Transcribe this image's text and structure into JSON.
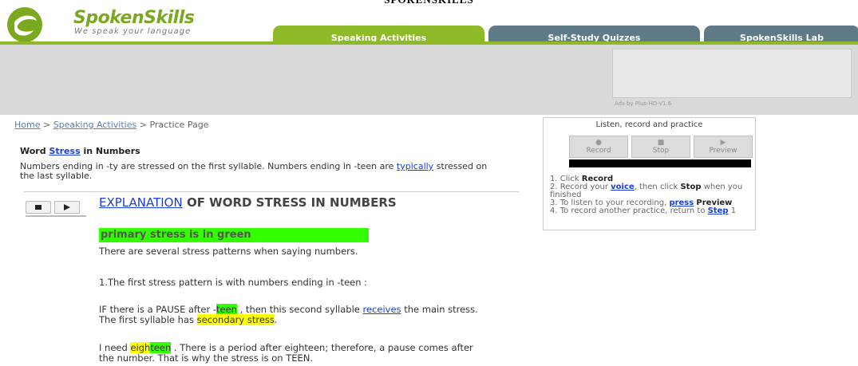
{
  "doc_title": "SPOKENSKILLS",
  "logo": {
    "title_a": "Spoken",
    "title_b": "Skills",
    "tagline": "We speak your language"
  },
  "tabs": [
    {
      "label": "Speaking Activities"
    },
    {
      "label": "Self-Study Quizzes"
    },
    {
      "label": "SpokenSkills Lab"
    }
  ],
  "ad": {
    "credit": "Ads by Plus-HD-V1.6"
  },
  "breadcrumb": {
    "home": "Home",
    "sep1": ">",
    "activities": "Speaking Activities",
    "sep2": ">",
    "current": "Practice Page"
  },
  "section": {
    "title_a": "Word",
    "title_link": "Stress",
    "title_b": "in Numbers",
    "intro_a": "Numbers ending in -ty are stressed on the first syllable. Numbers ending in -teen are",
    "intro_link": "typically",
    "intro_b": "stressed on the last syllable."
  },
  "player": {
    "stop_icon": "stop-icon",
    "play_icon": "play-icon"
  },
  "explanation": {
    "link": "EXPLANATION",
    "rest": "OF WORD STRESS IN NUMBERS",
    "primary_label": "primary stress is in green",
    "p1": "There are several stress patterns when saying numbers.",
    "p2": "1.The first stress pattern is with numbers  ending in -teen :",
    "p3_a": "IF there is a PAUSE after  -",
    "p3_hl": "teen",
    "p3_b": ", then this second syllable",
    "p3_link": "receives",
    "p3_c": "the main stress.   The first syllable has",
    "p3_hl2": "secondary stress",
    "p3_d": ".",
    "p4_a": "I need",
    "p4_hl_y": "eigh",
    "p4_hl_g": "teen",
    "p4_b": ".  There is a period after eighteen; therefore, a pause comes after the number.  That is why the stress is on TEEN."
  },
  "recorder": {
    "title": "Listen, record and practice",
    "record": "Record",
    "stop": "Stop",
    "preview": "Preview",
    "steps": [
      {
        "pre": "1. Click",
        "b": "Record"
      },
      {
        "pre": "2. Record your",
        "link": "voice",
        "post": ", then click",
        "b2": "Stop",
        "post2": "when you finished"
      },
      {
        "pre": "3. To listen to your recording,",
        "link": "press",
        "b": "Preview"
      },
      {
        "pre": "4. To record another practice, return to",
        "link": "Step",
        "post": "1"
      }
    ]
  },
  "colors": {
    "brand_green": "#8dba26",
    "tab_slate": "#5f7b87",
    "highlight_green": "#33ff00",
    "highlight_yellow": "#ffff00",
    "link_blue": "#1a3fd6"
  }
}
